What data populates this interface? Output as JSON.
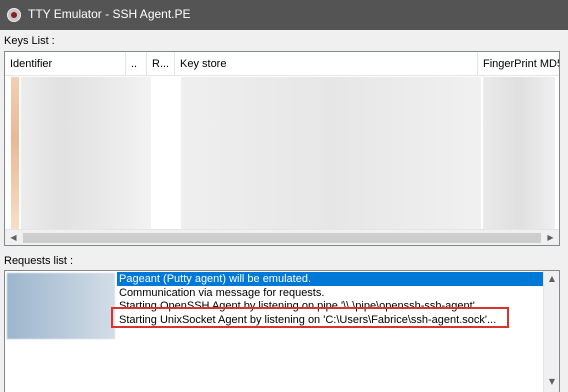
{
  "window": {
    "title": "TTY Emulator - SSH Agent.PE",
    "icon": "app-icon"
  },
  "keys_list": {
    "label": "Keys List :",
    "columns": [
      "Identifier",
      "..",
      "R...",
      "Key store",
      "FingerPrint MD5"
    ],
    "scroll_left_glyph": "◀",
    "scroll_right_glyph": "▶"
  },
  "requests_list": {
    "label": "Requests list :",
    "rows": [
      "Pageant (Putty agent) will be emulated.",
      "Communication via message for requests.",
      "Starting OpenSSH Agent by listening on pipe '\\\\.\\pipe\\openssh-ssh-agent'",
      "Starting UnixSocket Agent by listening on 'C:\\Users\\Fabrice\\ssh-agent.sock'..."
    ],
    "selected_row": 0,
    "highlight_color": "#d9342b",
    "selection_color": "#0078d7",
    "scroll_up_glyph": "▲",
    "scroll_down_glyph": "▼"
  }
}
